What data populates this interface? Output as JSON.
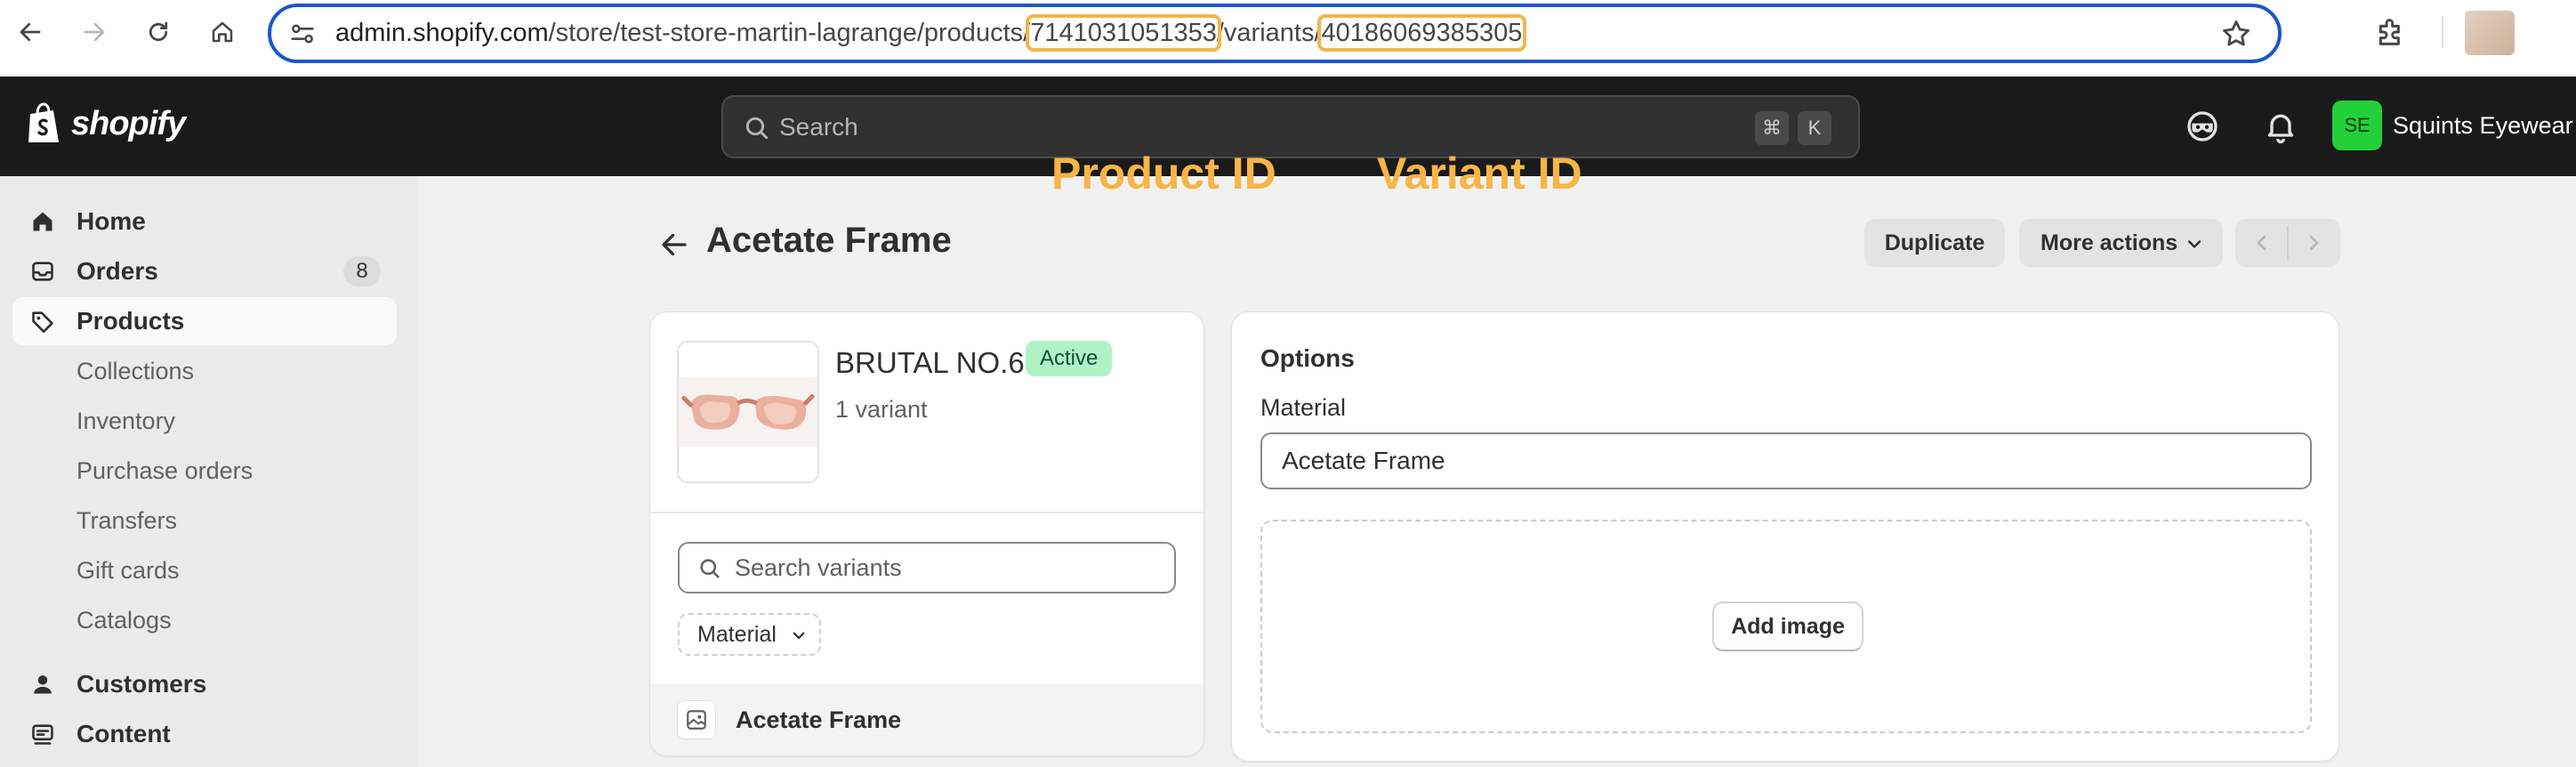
{
  "browser": {
    "url_host": "admin.shopify.com",
    "url_path_1": "/store/test-store-martin-lagrange/products/",
    "url_product_id": "7141031051353",
    "url_path_2": "/variants/",
    "url_variant_id": "40186069385305",
    "annotation_product": "Product ID",
    "annotation_variant": "Variant ID"
  },
  "topbar": {
    "logo_text": "shopify",
    "search_placeholder": "Search",
    "shortcut_1": "⌘",
    "shortcut_2": "K",
    "store_initials": "SE",
    "store_name": "Squints Eyewear"
  },
  "sidebar": {
    "items": [
      {
        "label": "Home",
        "icon": "home-icon"
      },
      {
        "label": "Orders",
        "icon": "inbox-icon",
        "badge": "8"
      },
      {
        "label": "Products",
        "icon": "tag-icon",
        "active": true
      },
      {
        "label": "Customers",
        "icon": "person-icon"
      },
      {
        "label": "Content",
        "icon": "content-icon"
      }
    ],
    "sub_items": [
      "Collections",
      "Inventory",
      "Purchase orders",
      "Transfers",
      "Gift cards",
      "Catalogs"
    ]
  },
  "page": {
    "title": "Acetate Frame",
    "duplicate_label": "Duplicate",
    "more_actions_label": "More actions"
  },
  "product_card": {
    "name": "BRUTAL NO.6",
    "status": "Active",
    "variant_count": "1 variant",
    "search_placeholder": "Search variants",
    "filter_label": "Material",
    "variant_name": "Acetate Frame"
  },
  "options_card": {
    "title": "Options",
    "field_label": "Material",
    "field_value": "Acetate Frame",
    "add_image_label": "Add image"
  },
  "colors": {
    "accent_blue": "#1a57c7",
    "annotation_orange": "#f7b546",
    "active_badge": "#aff2c6",
    "store_avatar": "#22d13a"
  }
}
